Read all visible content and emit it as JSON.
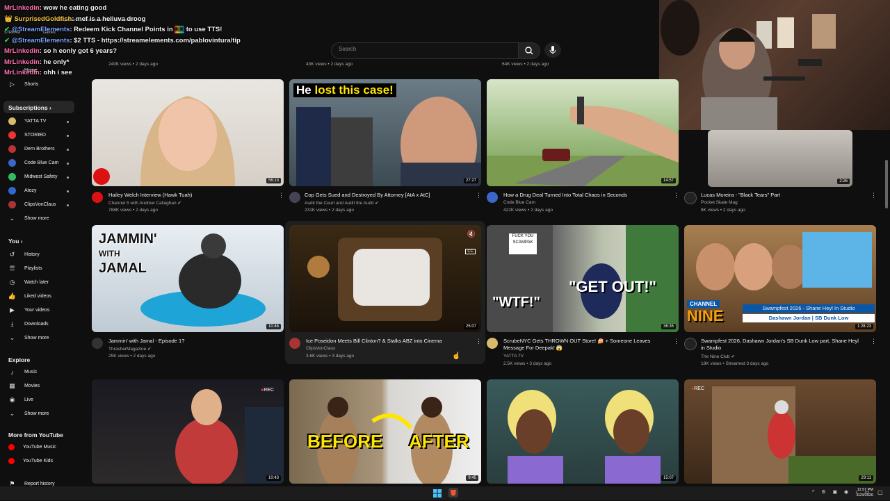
{
  "search": {
    "placeholder": "Search"
  },
  "chat": [
    {
      "user": "MrLinkedin",
      "msg": "wow he eating good",
      "color": "#ff6fae"
    },
    {
      "user": "SurprisedGoldfish",
      "msg": "mef is a helluva droog",
      "color": "#f6c343"
    },
    {
      "user": "@StreamElements",
      "msg": "Redeem Kick Channel Points in",
      "msg2": "to use TTS!",
      "color": "#7aa7ff"
    },
    {
      "user": "@StreamElements",
      "msg": "$2 TTS - https://streamelements.com/pablovintura/tip",
      "color": "#7aa7ff"
    },
    {
      "user": "MrLinkedin",
      "msg": "so h eonly got 6 years?",
      "color": "#ff6fae"
    },
    {
      "user": "MrLinkedin",
      "msg": "he only*",
      "color": "#ff6fae"
    },
    {
      "user": "MrLinkedin",
      "msg": "ohh i see",
      "color": "#ff6fae"
    }
  ],
  "browser": {
    "url": "https://www.youtube.com/feed/subscriptions",
    "stream_label": "STREAM",
    "games_label": "Games"
  },
  "sidebar": {
    "home": "Home",
    "shorts": "Shorts",
    "subscriptions_header": "Subscriptions",
    "subs": [
      "YATTA TV",
      "STORIED",
      "Dern Brothers",
      "Code Blue Cam",
      "Midwest Safety",
      "Atozy",
      "ClipsVonClaus"
    ],
    "sub_colors": [
      "#d9b96a",
      "#e33",
      "#b33",
      "#3a67c9",
      "#3b6",
      "#36c",
      "#a33"
    ],
    "show_more_1": "Show more",
    "you_header": "You",
    "you_items": [
      "History",
      "Playlists",
      "Watch later",
      "Liked videos",
      "Your videos",
      "Downloads"
    ],
    "show_more_2": "Show more",
    "explore_header": "Explore",
    "explore_items": [
      "Music",
      "Movies",
      "Live"
    ],
    "show_more_3": "Show more",
    "more_header": "More from YouTube",
    "more_items": [
      "YouTube Music",
      "YouTube Kids"
    ],
    "report": "Report history"
  },
  "top_meta": [
    "240K views • 2 days ago",
    "43K views • 2 days ago",
    "64K views • 2 days ago"
  ],
  "row1": [
    {
      "title": "Hailey Welch Interview (Hawk Tuah)",
      "channel": "Channel 5 with Andrew Callaghan",
      "meta": "788K views • 2 days ago",
      "duration": "56:13"
    },
    {
      "title": "Cop Gets Sued and Destroyed By Attorney [AtA x AtC]",
      "channel": "Audit the Court and Audit the Audit",
      "meta": "231K views • 2 days ago",
      "duration": "27:27",
      "overlay_a": "He ",
      "overlay_b": "lost this case!"
    },
    {
      "title": "How a Drug Deal Turned Into Total Chaos in Seconds",
      "channel": "Code Blue Cam",
      "meta": "422K views • 2 days ago",
      "duration": "14:57"
    },
    {
      "title": "Lucas Moreira - \"Black Tears\" Part",
      "channel": "Pocket Skate Mag",
      "meta": "8K views • 2 days ago",
      "duration": "2:26"
    }
  ],
  "row2": [
    {
      "title": "Jammin' with Jamal - Episode 1?",
      "channel": "ThrasherMagazine",
      "meta": "25K views • 2 days ago",
      "duration": "10:46",
      "overlay_a": "JAMMIN'",
      "overlay_b": "WITH",
      "overlay_c": "JAMAL"
    },
    {
      "title": "Ice Poseidon Meets Bill Clinton? & Stalks ABZ into Cinema",
      "channel": "ClipsVonClaus",
      "meta": "3.6K views • 3 days ago",
      "duration": "25:07"
    },
    {
      "title": "ScrubeNYC Gets THROWN OUT Store! 🍰 + Someone Leaves",
      "title2": "Message For Deepak! 😱",
      "channel": "YATTA TV",
      "meta": "2.5K views • 3 days ago",
      "duration": "36:35",
      "overlay_a": "\"WTF!\"",
      "overlay_b": "\"GET OUT!\"",
      "sign": "FUCK YOU SCAMPAK"
    },
    {
      "title": "Swampfest 2026, Dashawn Jordan's SB Dunk Low part, Shane Heyl",
      "title2": "in Studio",
      "channel": "The Nine Club",
      "meta": "18K views • Streamed 3 days ago",
      "duration": "1:28:23",
      "overlay_a": "CHANNEL",
      "overlay_b": "NINE",
      "banner1": "Swampfest 2026 - Shane Heyl In Studio",
      "banner2": "Dashawn Jordan | SB Dunk Low"
    }
  ],
  "row3": [
    {
      "duration": "10:43",
      "rec": "REC"
    },
    {
      "duration": "9:45",
      "overlay_a": "BEFORE",
      "overlay_b": "AFTER"
    },
    {
      "duration": "15:07"
    },
    {
      "duration": "29:11",
      "rec": "REC"
    }
  ],
  "clock": {
    "time": "11:57 PM",
    "date": "3/23/2026"
  }
}
